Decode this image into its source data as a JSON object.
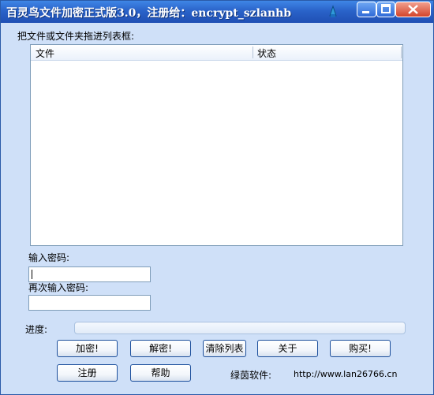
{
  "window": {
    "title": "百灵鸟文件加密正式版3.0，注册给：encrypt_szlanhb"
  },
  "drop_label": "把文件或文件夹拖进列表框:",
  "file_list": {
    "columns": [
      {
        "label": "文件"
      },
      {
        "label": "状态"
      }
    ],
    "rows": []
  },
  "password": {
    "label": "输入密码:",
    "value": ""
  },
  "password_confirm": {
    "label": "再次输入密码:",
    "value": ""
  },
  "progress": {
    "label": "进度:",
    "value": 0
  },
  "buttons": {
    "encrypt": "加密!",
    "decrypt": "解密!",
    "clear_list": "清除列表",
    "about": "关于",
    "buy": "购买!",
    "register": "注册",
    "help": "帮助"
  },
  "footer": {
    "vendor_label": "绿茵软件:",
    "url": "http://www.lan26766.cn"
  },
  "icons": {
    "titlebar": "pin-icon",
    "minimize": "minimize-icon",
    "maximize": "maximize-icon",
    "close": "close-icon"
  }
}
